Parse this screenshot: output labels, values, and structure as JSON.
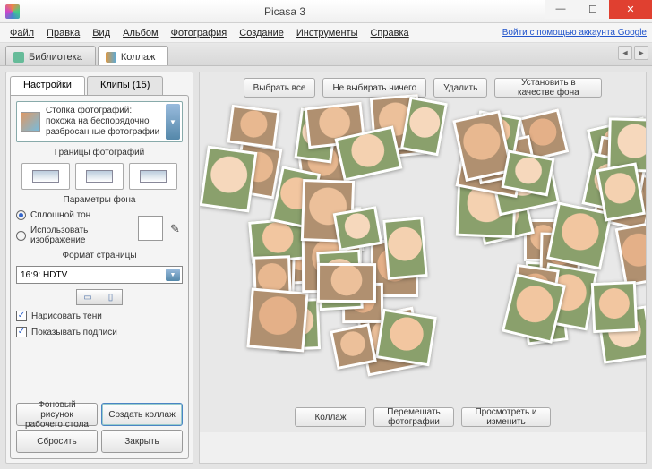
{
  "window": {
    "title": "Picasa 3"
  },
  "menu": {
    "file": "Файл",
    "edit": "Правка",
    "view": "Вид",
    "album": "Альбом",
    "photo": "Фотография",
    "create": "Создание",
    "tools": "Инструменты",
    "help": "Справка"
  },
  "signin": "Войти с помощью аккаунта Google",
  "tabs": {
    "library": "Библиотека",
    "collage": "Коллаж"
  },
  "side_tabs": {
    "settings": "Настройки",
    "clips": "Клипы (15)"
  },
  "stack": {
    "text": "Стопка фотографий: похожа на беспорядочно разбросанные фотографии"
  },
  "sections": {
    "borders": "Границы фотографий",
    "background": "Параметры фона",
    "format": "Формат страницы"
  },
  "bg": {
    "solid": "Сплошной тон",
    "use_image": "Использовать изображение"
  },
  "format_value": "16:9: HDTV",
  "checks": {
    "shadows": "Нарисовать тени",
    "captions": "Показывать подписи"
  },
  "buttons": {
    "wallpaper": "Фоновый рисунок рабочего стола",
    "create": "Создать коллаж",
    "reset": "Сбросить",
    "close": "Закрыть"
  },
  "top_actions": {
    "select_all": "Выбрать все",
    "select_none": "Не выбирать ничего",
    "delete": "Удалить",
    "set_bg": "Установить в качестве фона"
  },
  "bottom_actions": {
    "collage": "Коллаж",
    "shuffle": "Перемешать фотографии",
    "preview": "Просмотреть и изменить"
  }
}
